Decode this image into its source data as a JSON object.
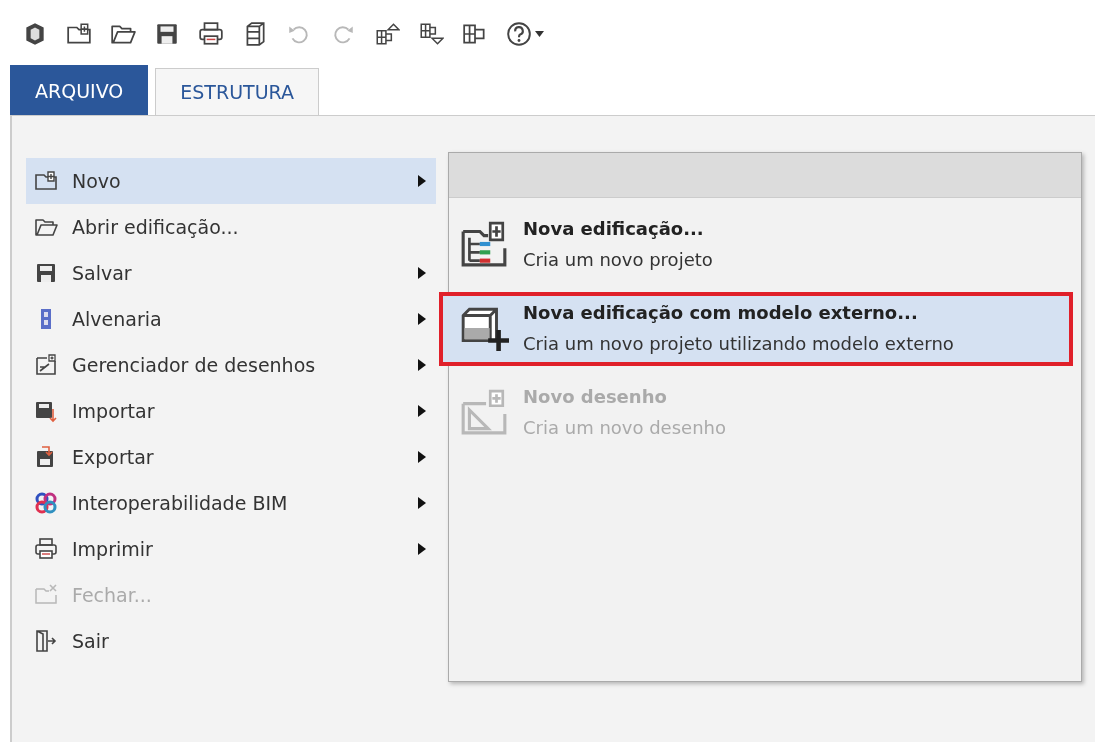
{
  "toolbar": [
    {
      "kind": "logo",
      "disabled": false
    },
    {
      "kind": "new",
      "disabled": false
    },
    {
      "kind": "open",
      "disabled": false
    },
    {
      "kind": "save",
      "disabled": false
    },
    {
      "kind": "print",
      "disabled": false
    },
    {
      "kind": "cabinet",
      "disabled": false
    },
    {
      "kind": "undo",
      "disabled": true
    },
    {
      "kind": "redo",
      "disabled": true
    },
    {
      "kind": "up",
      "disabled": false
    },
    {
      "kind": "down",
      "disabled": false
    },
    {
      "kind": "blocks",
      "disabled": false
    },
    {
      "kind": "help",
      "disabled": false
    }
  ],
  "tabs": [
    {
      "label": "ARQUIVO",
      "selected": true
    },
    {
      "label": "ESTRUTURA",
      "selected": false
    }
  ],
  "menu": [
    {
      "label": "Novo",
      "kind": "new",
      "submenu": true,
      "selected": true,
      "disabled": false
    },
    {
      "label": "Abrir edificação...",
      "kind": "open",
      "submenu": false,
      "selected": false,
      "disabled": false
    },
    {
      "label": "Salvar",
      "kind": "save",
      "submenu": true,
      "selected": false,
      "disabled": false
    },
    {
      "label": "Alvenaria",
      "kind": "wall",
      "submenu": true,
      "selected": false,
      "disabled": false
    },
    {
      "label": "Gerenciador de desenhos",
      "kind": "drawings",
      "submenu": true,
      "selected": false,
      "disabled": false
    },
    {
      "label": "Importar",
      "kind": "import",
      "submenu": true,
      "selected": false,
      "disabled": false
    },
    {
      "label": "Exportar",
      "kind": "export",
      "submenu": true,
      "selected": false,
      "disabled": false
    },
    {
      "label": "Interoperabilidade BIM",
      "kind": "bim",
      "submenu": true,
      "selected": false,
      "disabled": false
    },
    {
      "label": "Imprimir",
      "kind": "print",
      "submenu": true,
      "selected": false,
      "disabled": false
    },
    {
      "label": "Fechar...",
      "kind": "close",
      "submenu": false,
      "selected": false,
      "disabled": true
    },
    {
      "label": "Sair",
      "kind": "exit",
      "submenu": false,
      "selected": false,
      "disabled": false
    }
  ],
  "submenu": [
    {
      "title": "Nova edificação...",
      "description": "Cria um novo projeto",
      "kind": "building",
      "selected": false,
      "outlined": false,
      "disabled": false
    },
    {
      "title": "Nova edificação com modelo externo...",
      "description": "Cria um novo projeto utilizando modelo externo",
      "kind": "model",
      "selected": true,
      "outlined": true,
      "disabled": false
    },
    {
      "title": "Novo desenho",
      "description": "Cria um novo desenho",
      "kind": "drawing",
      "selected": false,
      "outlined": false,
      "disabled": true
    }
  ]
}
